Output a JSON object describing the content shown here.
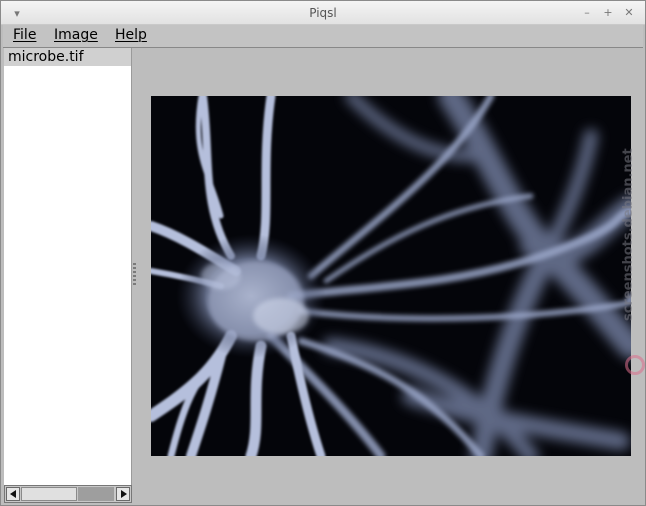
{
  "window": {
    "title": "Piqsl",
    "menu_icon": "chevron-down-icon",
    "controls": [
      "minimize-icon",
      "maximize-icon",
      "close-icon"
    ]
  },
  "menu": {
    "file": "File",
    "image": "Image",
    "help": "Help"
  },
  "sidebar": {
    "items": [
      {
        "label": "microbe.tif",
        "selected": true
      }
    ]
  },
  "scrollbar": {
    "left_icon": "arrow-left-icon",
    "right_icon": "arrow-right-icon"
  },
  "image": {
    "description_icon": "neuron-image",
    "background": "#05060a",
    "tint": "#a8b4d6"
  },
  "watermark": {
    "text": "screenshots.debian.net"
  }
}
